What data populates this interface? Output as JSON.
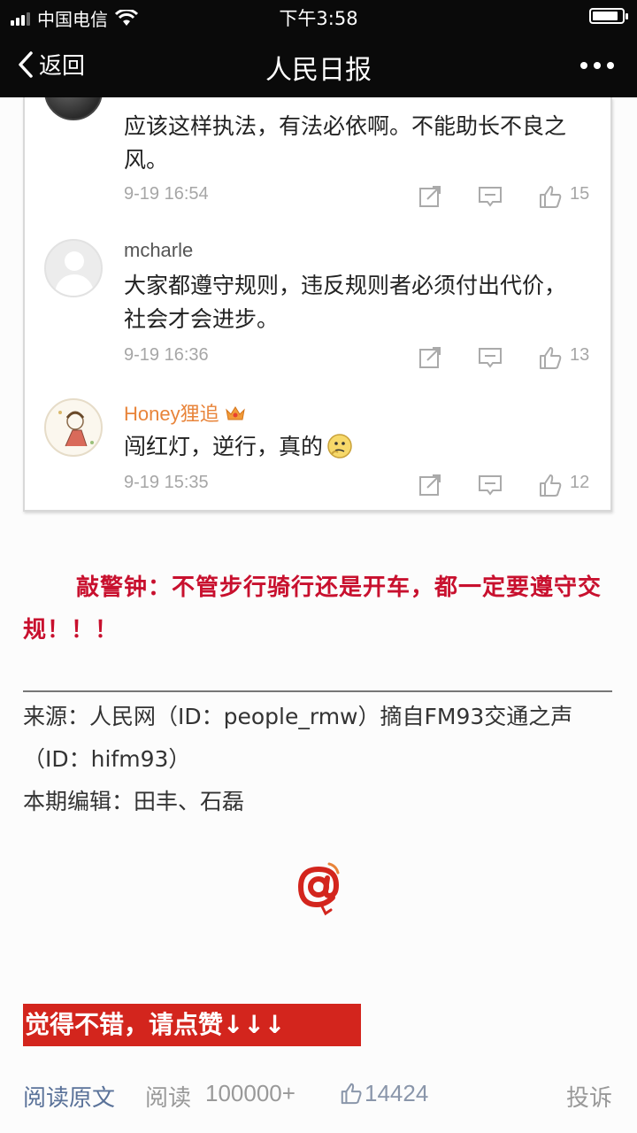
{
  "status_bar": {
    "carrier": "中国电信",
    "time": "下午3:58"
  },
  "nav": {
    "back_label": "返回",
    "title": "人民日报"
  },
  "comments": [
    {
      "name": "",
      "text": "应该这样执法，有法必依啊。不能助长不良之风。",
      "time": "9-19 16:54",
      "likes": "15"
    },
    {
      "name": "mcharle",
      "text": "大家都遵守规则，违反规则者必须付出代价，社会才会进步。",
      "time": "9-19 16:36",
      "likes": "13"
    },
    {
      "name": "Honey狸追",
      "text": "闯红灯，逆行，真的",
      "time": "9-19 15:35",
      "likes": "12"
    }
  ],
  "article": {
    "warning": "敲警钟：不管步行骑行还是开车，都一定要遵守交规！！！",
    "source": "来源：人民网（ID：people_rmw）摘自FM93交通之声（ID：hifm93）",
    "editor": "本期编辑：田丰、石磊",
    "like_banner": "觉得不错，请点赞↓↓↓"
  },
  "bottom_bar": {
    "read_original": "阅读原文",
    "read_label": "阅读",
    "read_count": "100000+",
    "like_count": "14424",
    "report": "投诉"
  },
  "colors": {
    "warning_red": "#c8102e",
    "banner_red": "#d3251d",
    "link_blue": "#5a7299",
    "vip_orange": "#e8843a"
  },
  "icons": [
    "signal-icon",
    "wifi-icon",
    "battery-icon",
    "chevron-left-icon",
    "more-icon",
    "share-icon",
    "reply-icon",
    "like-icon",
    "crown-icon",
    "emoji-icon",
    "at-logo"
  ]
}
